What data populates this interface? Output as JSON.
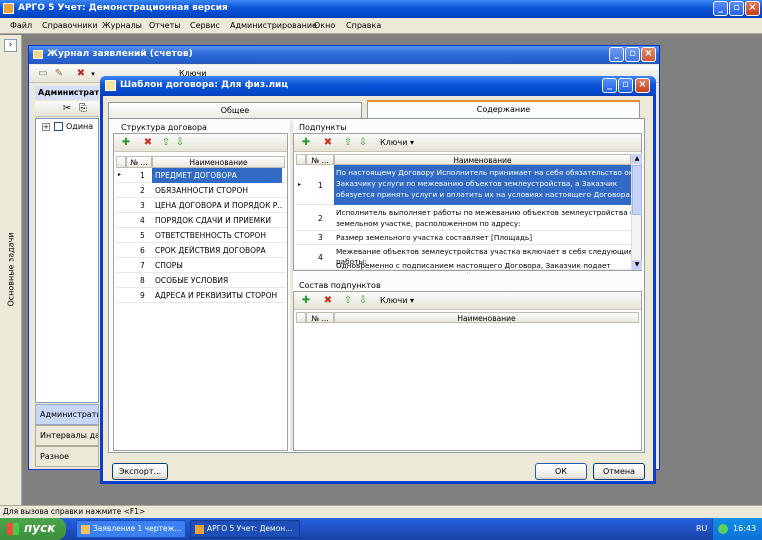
{
  "app": {
    "title": "АРГО 5 Учет: Демонстрационная версия"
  },
  "menu": [
    "Файл",
    "Справочники",
    "Журналы",
    "Отчеты",
    "Сервис",
    "Администрирование",
    "Окно",
    "Справка"
  ],
  "sidebar": {
    "label": "Основные задачи"
  },
  "journal": {
    "title": "Журнал заявлений (счетов)",
    "toolbar_label": "Ключи",
    "section_label": "Администрати",
    "tree_item": "Одина",
    "left_panels": [
      "Администрати",
      "Интервалы дат",
      "Разное"
    ]
  },
  "dialog": {
    "title": "Шаблон договора: Для физ.лиц",
    "tabs": [
      "Общее",
      "Содержание"
    ],
    "structure": {
      "label": "Структура договора",
      "columns": [
        "№ ...",
        "Наименование"
      ],
      "rows": [
        {
          "num": "1",
          "name": "ПРЕДМЕТ ДОГОВОРА",
          "selected": true
        },
        {
          "num": "2",
          "name": "ОБЯЗАННОСТИ СТОРОН"
        },
        {
          "num": "3",
          "name": "ЦЕНА ДОГОВОРА И ПОРЯДОК Р..."
        },
        {
          "num": "4",
          "name": "ПОРЯДОК СДАЧИ И ПРИЕМКИ"
        },
        {
          "num": "5",
          "name": "ОТВЕТСТВЕННОСТЬ СТОРОН"
        },
        {
          "num": "6",
          "name": "СРОК ДЕЙСТВИЯ ДОГОВОРА"
        },
        {
          "num": "7",
          "name": "СПОРЫ"
        },
        {
          "num": "8",
          "name": "ОСОБЫЕ УСЛОВИЯ"
        },
        {
          "num": "9",
          "name": "АДРЕСА И РЕКВИЗИТЫ СТОРОН"
        }
      ]
    },
    "subpoints": {
      "label": "Подпункты",
      "keys_label": "Ключи",
      "columns": [
        "№ ...",
        "Наименование"
      ],
      "rows": [
        {
          "num": "1",
          "lines": [
            "По настоящему Договору Исполнитель принимает на себя обязательство оказать",
            "Заказчику услуги по межеванию объектов землеустройства, а Заказчик",
            "обязуется принять услуги и оплатить их на условиях настоящего Договора."
          ],
          "selected": true
        },
        {
          "num": "2",
          "lines": [
            "Исполнитель выполняет работы по межеванию объектов землеустройства на",
            "земельном участке, расположенном по адресу:"
          ]
        },
        {
          "num": "3",
          "lines": [
            "Размер земельного участка составляет [Площадь]"
          ]
        },
        {
          "num": "4",
          "lines": [
            "Межевание объектов землеустройства участка включает в себя следующие",
            "работы:"
          ]
        },
        {
          "num": "",
          "lines": [
            "Одновременно с подписанием настоящего Договора, Заказчик подает"
          ]
        }
      ]
    },
    "composition": {
      "label": "Состав подпунктов",
      "keys_label": "Ключи",
      "columns": [
        "№ ...",
        "Наименование"
      ]
    },
    "export_label": "Экспорт...",
    "ok_label": "ОК",
    "cancel_label": "Отмена"
  },
  "status": {
    "text": "Для вызова справки нажмите <F1>"
  },
  "taskbar": {
    "start": "пуск",
    "tasks": [
      "Заявление 1 чертеж...",
      "АРГО 5 Учет: Демон..."
    ],
    "lang": "RU",
    "clock": "16:43"
  }
}
